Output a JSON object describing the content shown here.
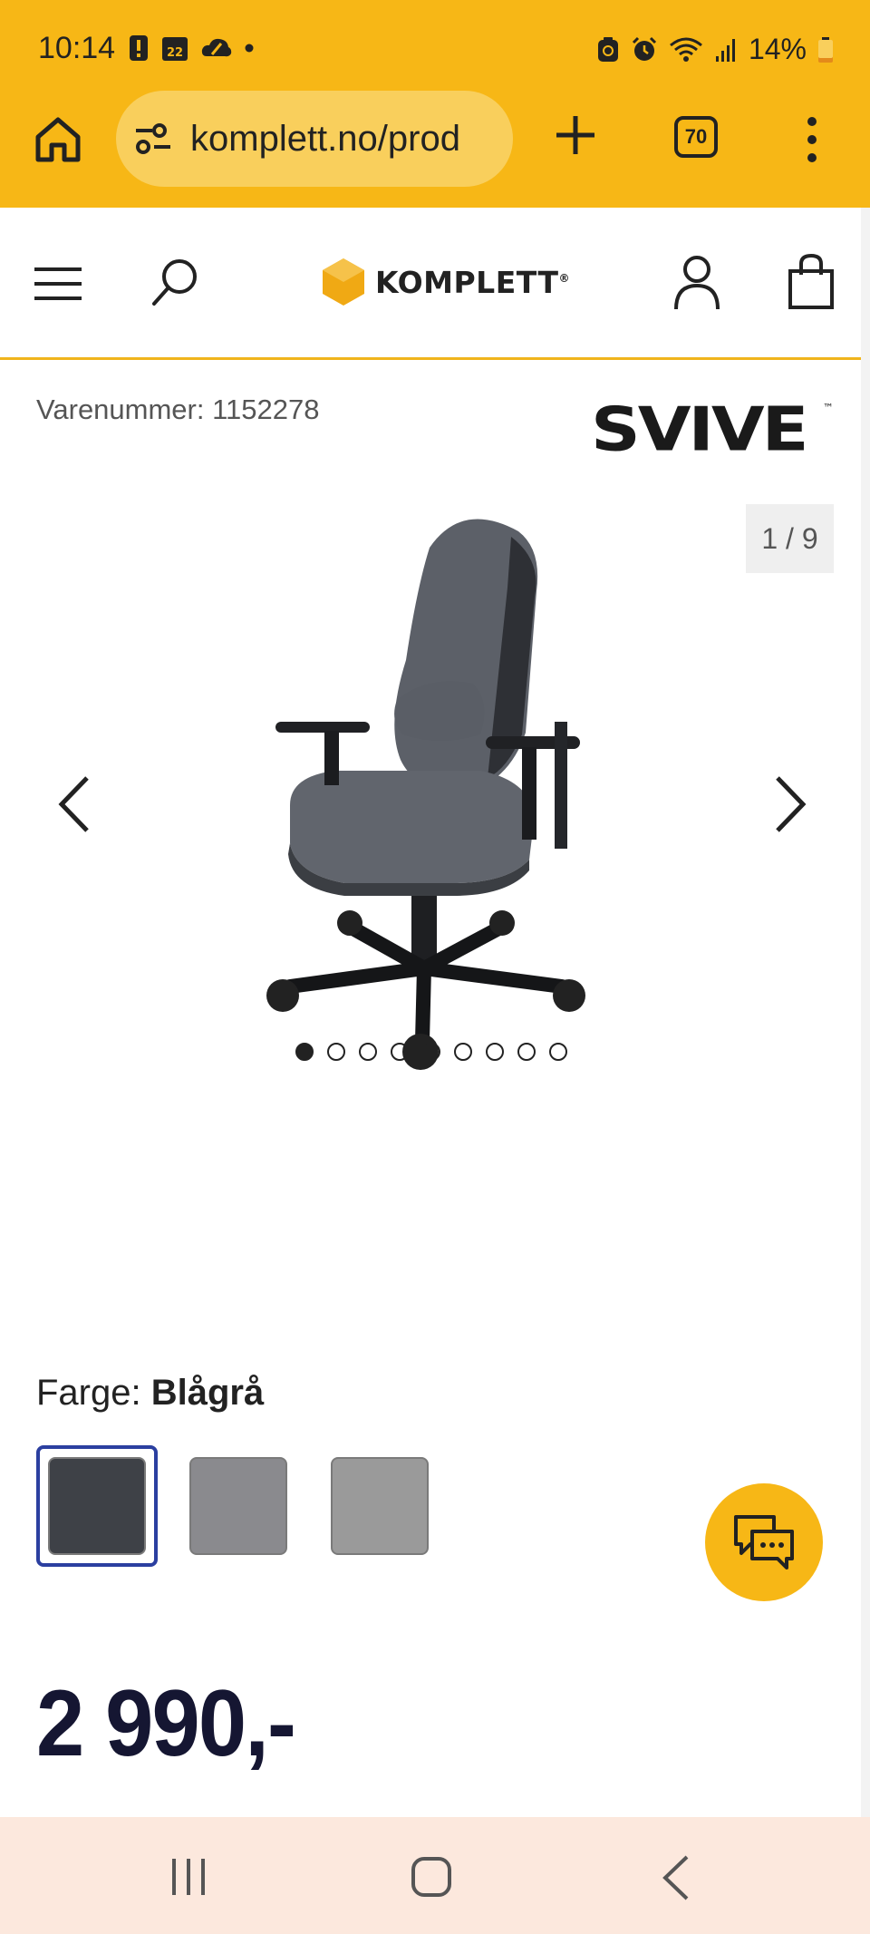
{
  "status_bar": {
    "time": "10:14",
    "calendar_day": "22",
    "battery_text": "14%",
    "icons_left": [
      "alert-icon",
      "calendar-icon",
      "cloud-icon",
      "dot-icon"
    ],
    "icons_right": [
      "battery-saver-icon",
      "alarm-icon",
      "wifi-icon",
      "signal-icon",
      "battery-icon"
    ]
  },
  "browser": {
    "url": "komplett.no/prod",
    "tab_count": "70"
  },
  "header": {
    "logo_text": "KOMPLETT",
    "logo_mark": "®"
  },
  "product": {
    "sku_label": "Varenummer: 1152278",
    "brand": "SVIVE",
    "brand_tm": "™",
    "image_counter": "1 / 9",
    "image_total": 9,
    "image_index": 1,
    "color_label": "Farge:",
    "color_value": "Blågrå",
    "swatches": [
      {
        "color": "#3e4147",
        "selected": true
      },
      {
        "color": "#8a8a8e",
        "selected": false
      },
      {
        "color": "#9a9a9a",
        "selected": false
      }
    ],
    "price": "2 990,-"
  },
  "colors": {
    "browser_yellow": "#f7b716",
    "url_pill": "#f9cf5c",
    "accent_border": "#f0b41c",
    "selected_swatch_border": "#2b3fa0",
    "price_text": "#151632",
    "nav_bar_bg": "#fce8dd"
  }
}
